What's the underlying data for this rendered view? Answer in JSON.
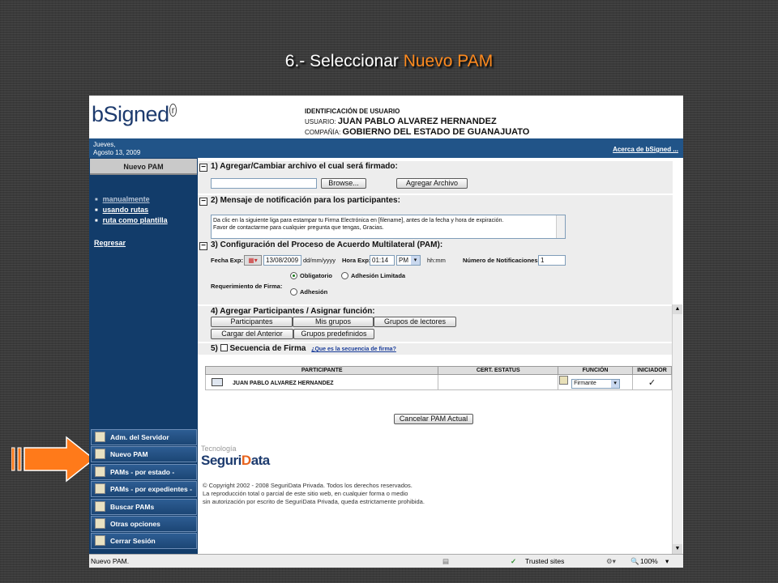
{
  "slide": {
    "title_prefix": "6.- Seleccionar ",
    "title_highlight": "Nuevo PAM"
  },
  "colors": {
    "highlight": "#ff8a1e",
    "brand_blue": "#215488",
    "sidebar": "#123c6a"
  },
  "header": {
    "logo": "bSigned",
    "id_heading": "IDENTIFICACIÓN DE USUARIO",
    "user_label": "USUARIO:",
    "user_value": "JUAN PABLO ALVAREZ HERNANDEZ",
    "company_label": "COMPAÑÍA:",
    "company_value": "GOBIERNO DEL ESTADO DE GUANAJUATO"
  },
  "bar": {
    "day": "Jueves,",
    "date": "Agosto 13, 2009",
    "about": "Acerca de bSigned ..."
  },
  "sidebar": {
    "active": "Nuevo PAM",
    "options": [
      "manualmente",
      "usando rutas",
      "ruta como plantilla"
    ],
    "back": "Regresar",
    "menu": [
      "Adm. del Servidor",
      "Nuevo PAM",
      "PAMs - por estado -",
      "PAMs - por expedientes -",
      "Buscar PAMs",
      "Otras opciones",
      "Cerrar Sesión"
    ]
  },
  "sec1": {
    "title": "1) Agregar/Cambiar archivo el cual será firmado:",
    "browse": "Browse...",
    "add_file": "Agregar Archivo",
    "file_value": ""
  },
  "sec2": {
    "title": "2) Mensaje de notificación para los participantes:",
    "message_line1": "Da clic en la siguiente liga para estampar tu Firma Electrónica en [filename], antes de la fecha y hora de expiración.",
    "message_line2": "Favor de contactarme para cualquier pregunta que tengas, Gracias."
  },
  "sec3": {
    "title": "3) Configuración del Proceso de Acuerdo Multilateral (PAM):",
    "fecha_label": "Fecha Exp:",
    "fecha_value": "13/08/2009",
    "fecha_fmt": "dd/mm/yyyy",
    "hora_label": "Hora Exp:",
    "hora_value": "01:14",
    "ampm": "PM",
    "hora_fmt": "hh:mm",
    "notif_label": "Número de Notificaciones",
    "notif_value": "1",
    "req_label": "Requerimiento de Firma:",
    "opt_obligatorio": "Obligatorio",
    "opt_limitada": "Adhesión Limitada",
    "opt_adhesion": "Adhesión"
  },
  "sec4": {
    "title": "4) Agregar Participantes / Asignar función:",
    "btn_participantes": "Participantes",
    "btn_mis_grupos": "Mis grupos",
    "btn_lectores": "Grupos de lectores",
    "btn_cargar": "Cargar del Anterior",
    "btn_predef": "Grupos predefinidos"
  },
  "sec5": {
    "title": "5)",
    "title2": "Secuencia de Firma",
    "help": "¿Que es la secuencia de firma?"
  },
  "table": {
    "headers": [
      "PARTICIPANTE",
      "CERT. ESTATUS",
      "FUNCIÓN",
      "INICIADOR"
    ],
    "rows": [
      {
        "participante": "JUAN PABLO ALVAREZ HERNANDEZ",
        "cert": "",
        "funcion": "Firmante",
        "iniciador": "✓"
      }
    ]
  },
  "cancel": "Cancelar PAM Actual",
  "footer": {
    "tecnologia": "Tecnología",
    "brand1": "Seguri",
    "brand2": "D",
    "brand3": "ata",
    "copy1": "© Copyright 2002 - 2008 SeguriData Privada. Todos los derechos reservados.",
    "copy2": "La reproducción total o parcial de este sitio web, en cualquier forma o medio",
    "copy3": "sin autorización por escrito de SeguriData Privada, queda estrictamente prohibida."
  },
  "status": {
    "text": "Nuevo PAM.",
    "zone": "Trusted sites",
    "zoom": "100%"
  }
}
